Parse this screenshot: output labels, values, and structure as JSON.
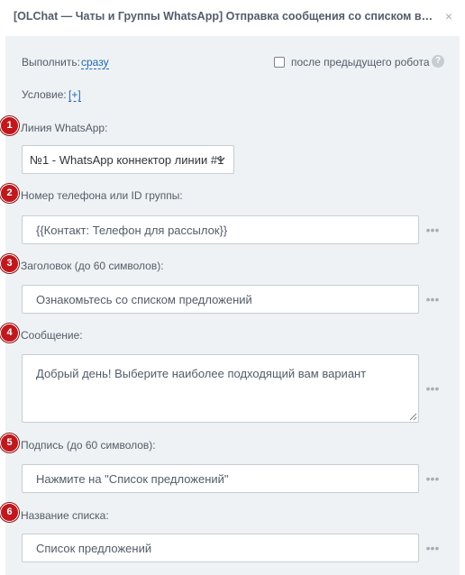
{
  "dialog": {
    "title": "[OLChat — Чаты и Группы WhatsApp] Отправка сообщения со списком выбо...",
    "close_label": "×"
  },
  "execute": {
    "label": "Выполнить:",
    "value": "сразу"
  },
  "after_previous": {
    "label": "после предыдущего робота",
    "checked": false,
    "help_label": "?"
  },
  "condition": {
    "label": "Условие:",
    "value": "[+]"
  },
  "more_label": "•••",
  "fields": [
    {
      "number": "1",
      "label": "Линия WhatsApp:",
      "type": "select",
      "value": "№1 - WhatsApp коннектор линии #1"
    },
    {
      "number": "2",
      "label": "Номер телефона или ID группы:",
      "type": "text",
      "value": "{{Контакт: Телефон для рассылок}}"
    },
    {
      "number": "3",
      "label": "Заголовок (до 60 символов):",
      "type": "text",
      "value": "Ознакомьтесь со списком предложений"
    },
    {
      "number": "4",
      "label": "Сообщение:",
      "type": "textarea",
      "value": "Добрый день! Выберите наиболее подходящий вам вариант"
    },
    {
      "number": "5",
      "label": "Подпись (до 60 символов):",
      "type": "text",
      "value": "Нажмите на \"Список предложений\""
    },
    {
      "number": "6",
      "label": "Название списка:",
      "type": "text",
      "value": "Список предложений"
    }
  ],
  "colors": {
    "panel_background": "#eef2f4",
    "link": "#2067b0",
    "badge": "#c0181d",
    "input_border": "#c6cdd3"
  }
}
